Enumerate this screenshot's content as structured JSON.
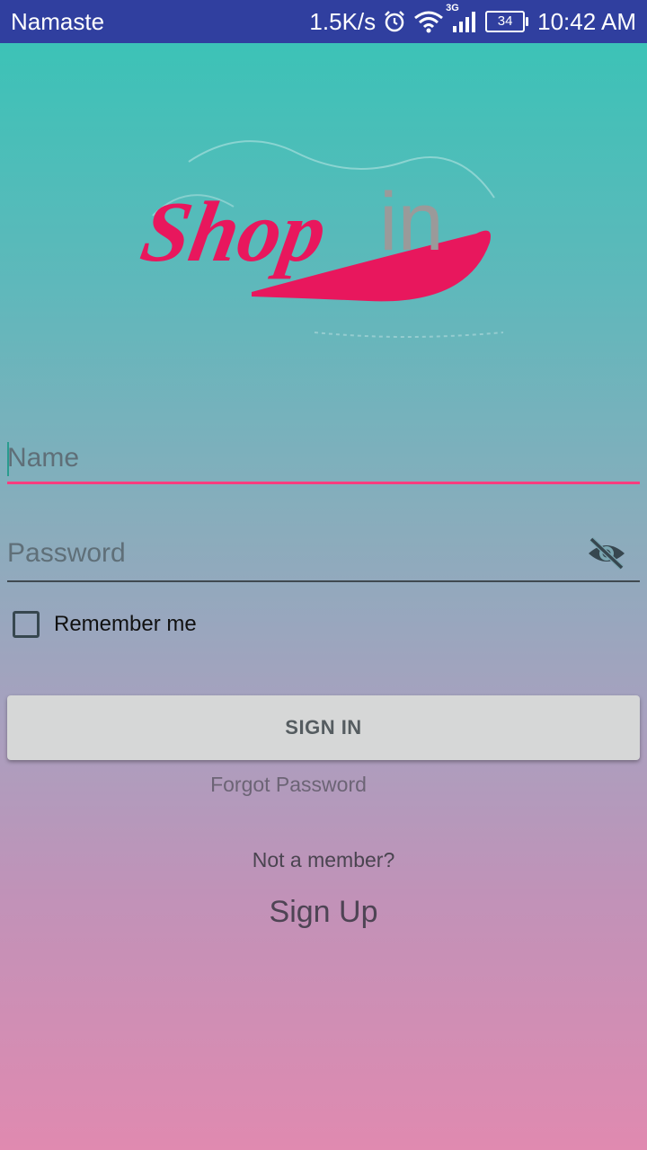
{
  "status_bar": {
    "carrier": "Namaste",
    "network_speed": "1.5K/s",
    "network_type": "3G",
    "battery": "34",
    "time": "10:42 AM",
    "icons": [
      "alarm-icon",
      "wifi-icon",
      "signal-icon",
      "battery-icon"
    ]
  },
  "logo": {
    "brand": "Shop",
    "suffix": "in",
    "brand_color": "#e8175d",
    "suffix_color": "#9a9a9a"
  },
  "form": {
    "name_placeholder": "Name",
    "password_placeholder": "Password",
    "remember_label": "Remember me",
    "sign_in_label": "SIGN IN",
    "forgot_label": "Forgot Password",
    "not_member_label": "Not a member?",
    "sign_up_label": "Sign Up"
  },
  "colors": {
    "status_bar": "#303f9f",
    "accent": "#ff3d7f",
    "gradient_top": "#36c4b6",
    "gradient_bottom": "#e08ab0"
  }
}
